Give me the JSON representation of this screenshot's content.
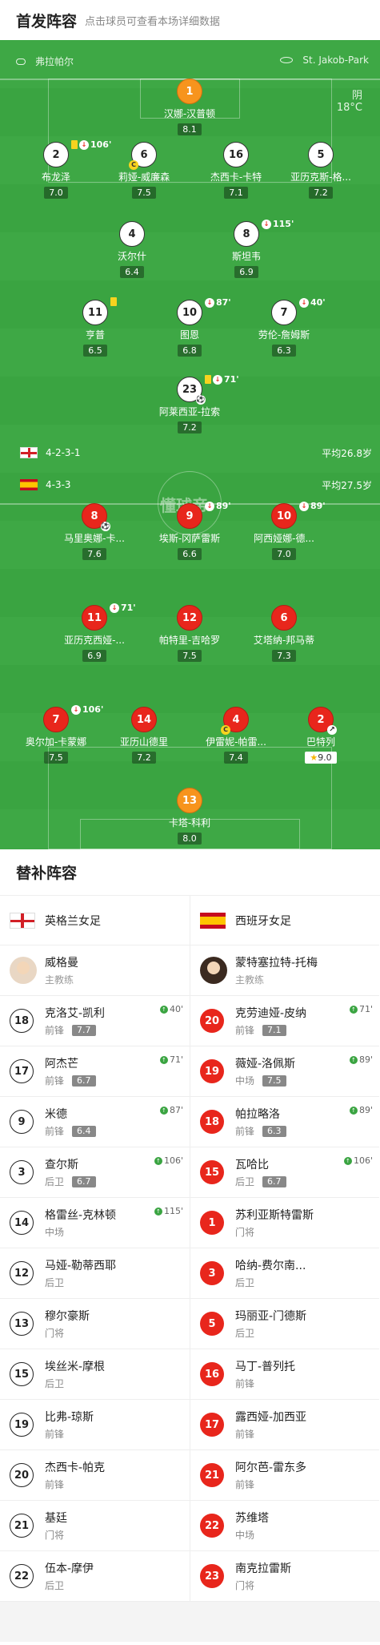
{
  "lineup_header": {
    "title": "首发阵容",
    "subtitle": "点击球员可查看本场详细数据"
  },
  "pitch": {
    "venue_left": "弗拉帕尔",
    "venue_right": "St. Jakob-Park",
    "weather": "阴",
    "temperature": "18°C",
    "watermark": "懂球帝",
    "home_formation": "4-2-3-1",
    "home_avg_age": "平均26.8岁",
    "away_formation": "4-3-3",
    "away_avg_age": "平均27.5岁"
  },
  "home_players": [
    {
      "num": "1",
      "name": "汉娜-汉普顿",
      "rating": "8.1",
      "type": "gk"
    },
    {
      "num": "2",
      "name": "布龙泽",
      "rating": "7.0",
      "event": "106'"
    },
    {
      "num": "6",
      "name": "莉娅-威廉森",
      "rating": "7.5"
    },
    {
      "num": "16",
      "name": "杰西卡-卡特",
      "rating": "7.1"
    },
    {
      "num": "5",
      "name": "亚历克斯-格...",
      "rating": "7.2"
    },
    {
      "num": "4",
      "name": "沃尔什",
      "rating": "6.4"
    },
    {
      "num": "8",
      "name": "斯坦韦",
      "rating": "6.9",
      "event": "115'"
    },
    {
      "num": "11",
      "name": "亨普",
      "rating": "6.5"
    },
    {
      "num": "10",
      "name": "图恩",
      "rating": "6.8",
      "event": "87'"
    },
    {
      "num": "7",
      "name": "劳伦-詹姆斯",
      "rating": "6.3",
      "event": "40'"
    },
    {
      "num": "23",
      "name": "阿莱西亚-拉索",
      "rating": "7.2",
      "event": "71'"
    }
  ],
  "away_players": [
    {
      "num": "8",
      "name": "马里奥娜-卡...",
      "rating": "7.6"
    },
    {
      "num": "9",
      "name": "埃斯-冈萨雷斯",
      "rating": "6.6",
      "event": "89'"
    },
    {
      "num": "10",
      "name": "阿西娅娜-德...",
      "rating": "7.0",
      "event": "89'"
    },
    {
      "num": "11",
      "name": "亚历克西娅-...",
      "rating": "6.9",
      "event": "71'"
    },
    {
      "num": "12",
      "name": "帕特里-吉哈罗",
      "rating": "7.5"
    },
    {
      "num": "6",
      "name": "艾塔纳-邦马蒂",
      "rating": "7.3"
    },
    {
      "num": "7",
      "name": "奥尔加-卡蒙娜",
      "rating": "7.5",
      "event": "106'"
    },
    {
      "num": "14",
      "name": "亚历山德里",
      "rating": "7.2"
    },
    {
      "num": "4",
      "name": "伊雷妮-帕雷...",
      "rating": "7.4"
    },
    {
      "num": "2",
      "name": "巴特列",
      "rating": "9.0"
    },
    {
      "num": "13",
      "name": "卡塔-科利",
      "rating": "8.0",
      "type": "gk"
    }
  ],
  "subs_header": "替补阵容",
  "home_team": {
    "name": "英格兰女足",
    "coach": {
      "name": "威格曼",
      "role": "主教练"
    },
    "subs": [
      {
        "num": "18",
        "name": "克洛艾-凯利",
        "pos": "前锋",
        "rating": "7.7",
        "minute": "40'"
      },
      {
        "num": "17",
        "name": "阿杰芒",
        "pos": "前锋",
        "rating": "6.7",
        "minute": "71'"
      },
      {
        "num": "9",
        "name": "米德",
        "pos": "前锋",
        "rating": "6.4",
        "minute": "87'"
      },
      {
        "num": "3",
        "name": "查尔斯",
        "pos": "后卫",
        "rating": "6.7",
        "minute": "106'"
      },
      {
        "num": "14",
        "name": "格雷丝-克林顿",
        "pos": "中场",
        "minute": "115'"
      },
      {
        "num": "12",
        "name": "马娅-勒蒂西耶",
        "pos": "后卫"
      },
      {
        "num": "13",
        "name": "穆尔豪斯",
        "pos": "门将"
      },
      {
        "num": "15",
        "name": "埃丝米-摩根",
        "pos": "后卫"
      },
      {
        "num": "19",
        "name": "比弗-琼斯",
        "pos": "前锋"
      },
      {
        "num": "20",
        "name": "杰西卡-帕克",
        "pos": "前锋"
      },
      {
        "num": "21",
        "name": "基廷",
        "pos": "门将"
      },
      {
        "num": "22",
        "name": "伍本-摩伊",
        "pos": "后卫"
      }
    ]
  },
  "away_team": {
    "name": "西班牙女足",
    "coach": {
      "name": "蒙特塞拉特-托梅",
      "role": "主教练"
    },
    "subs": [
      {
        "num": "20",
        "name": "克劳迪娅-皮纳",
        "pos": "前锋",
        "rating": "7.1",
        "minute": "71'"
      },
      {
        "num": "19",
        "name": "薇娅-洛佩斯",
        "pos": "中场",
        "rating": "7.5",
        "minute": "89'"
      },
      {
        "num": "18",
        "name": "帕拉略洛",
        "pos": "前锋",
        "rating": "6.3",
        "minute": "89'"
      },
      {
        "num": "15",
        "name": "瓦哈比",
        "pos": "后卫",
        "rating": "6.7",
        "minute": "106'"
      },
      {
        "num": "1",
        "name": "苏利亚斯特雷斯",
        "pos": "门将"
      },
      {
        "num": "3",
        "name": "哈纳-费尔南...",
        "pos": "后卫"
      },
      {
        "num": "5",
        "name": "玛丽亚-门德斯",
        "pos": "后卫"
      },
      {
        "num": "16",
        "name": "马丁-普列托",
        "pos": "前锋"
      },
      {
        "num": "17",
        "name": "露西娅-加西亚",
        "pos": "前锋"
      },
      {
        "num": "21",
        "name": "阿尔芭-雷东多",
        "pos": "前锋"
      },
      {
        "num": "22",
        "name": "苏维塔",
        "pos": "中场"
      },
      {
        "num": "23",
        "name": "南克拉雷斯",
        "pos": "门将"
      }
    ]
  }
}
